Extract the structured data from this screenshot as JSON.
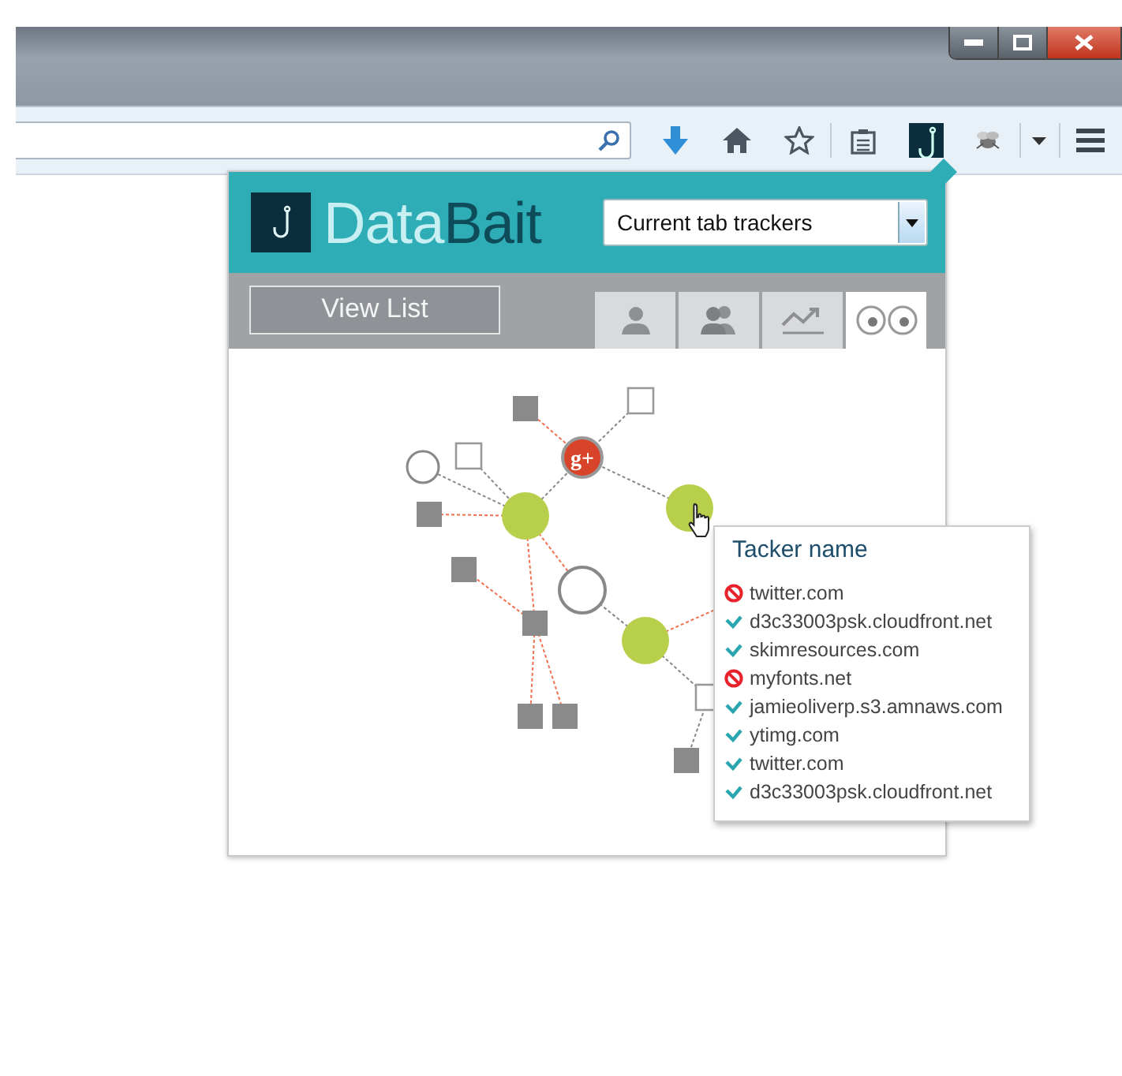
{
  "popup": {
    "logo": {
      "first": "Data",
      "second": "Bait"
    },
    "dropdown": {
      "value": "Current tab trackers"
    },
    "view_list_button": "View List",
    "tabs": [
      {
        "kind": "person",
        "selected": false
      },
      {
        "kind": "people",
        "selected": false
      },
      {
        "kind": "chart",
        "selected": false
      },
      {
        "kind": "eyes",
        "selected": true
      }
    ],
    "graph": {
      "badge": "g+"
    },
    "tooltip": {
      "title": "Tacker name",
      "trackers": [
        {
          "name": "twitter.com",
          "blocked": true
        },
        {
          "name": "d3c33003psk.cloudfront.net",
          "blocked": false
        },
        {
          "name": "skimresources.com",
          "blocked": false
        },
        {
          "name": "myfonts.net",
          "blocked": true
        },
        {
          "name": "jamieoliverp.s3.amnaws.com",
          "blocked": false
        },
        {
          "name": "ytimg.com",
          "blocked": false
        },
        {
          "name": "twitter.com",
          "blocked": false
        },
        {
          "name": "d3c33003psk.cloudfront.net",
          "blocked": false
        }
      ]
    }
  }
}
